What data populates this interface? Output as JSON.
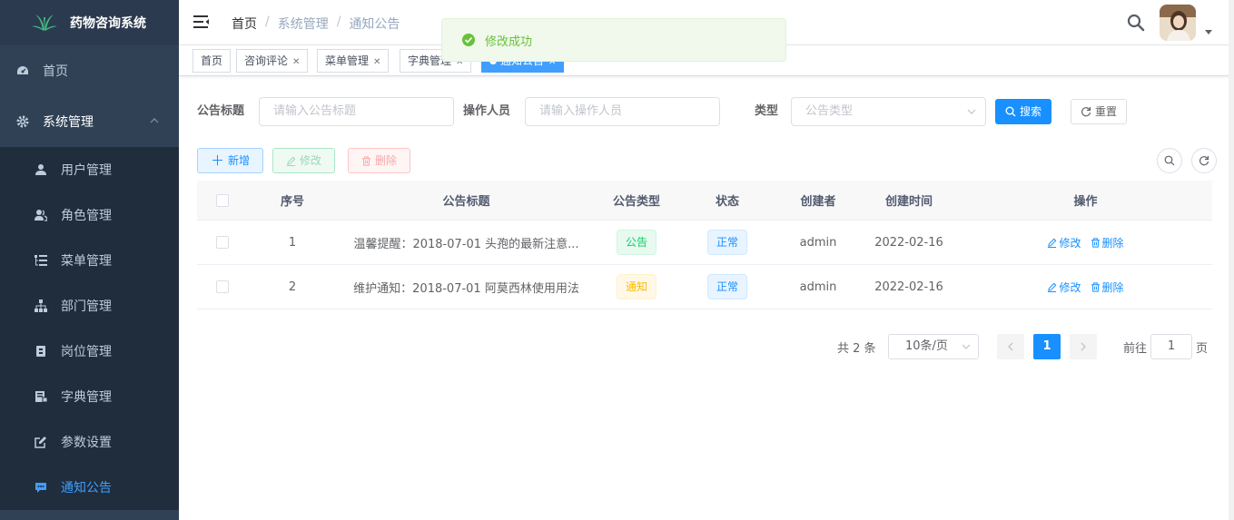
{
  "app": {
    "title": "药物咨询系统"
  },
  "sidebar": {
    "home": "首页",
    "system": "系统管理",
    "items": [
      {
        "label": "用户管理",
        "icon": "user-icon"
      },
      {
        "label": "角色管理",
        "icon": "peoples-icon"
      },
      {
        "label": "菜单管理",
        "icon": "tree-table-icon"
      },
      {
        "label": "部门管理",
        "icon": "tree-icon"
      },
      {
        "label": "岗位管理",
        "icon": "post-icon"
      },
      {
        "label": "字典管理",
        "icon": "dict-icon"
      },
      {
        "label": "参数设置",
        "icon": "edit-icon"
      },
      {
        "label": "通知公告",
        "icon": "message-icon",
        "active": true
      }
    ]
  },
  "breadcrumb": [
    "首页",
    "系统管理",
    "通知公告"
  ],
  "tags": [
    "首页",
    "咨询评论",
    "菜单管理",
    "字典管理",
    "通知公告"
  ],
  "toast": {
    "message": "修改成功",
    "color": "#67c23a"
  },
  "search": {
    "title_label": "公告标题",
    "title_placeholder": "请输入公告标题",
    "operator_label": "操作人员",
    "operator_placeholder": "请输入操作人员",
    "type_label": "类型",
    "type_placeholder": "公告类型",
    "search_btn": "搜索",
    "reset_btn": "重置"
  },
  "toolbar": {
    "add": "新增",
    "edit": "修改",
    "delete": "删除"
  },
  "table": {
    "headers": [
      "序号",
      "公告标题",
      "公告类型",
      "状态",
      "创建者",
      "创建时间",
      "操作"
    ],
    "rows": [
      {
        "no": "1",
        "title": "温馨提醒：2018-07-01 头孢的最新注意...",
        "type": "公告",
        "status": "正常",
        "creator": "admin",
        "time": "2022-02-16",
        "edit": "修改",
        "delete": "删除"
      },
      {
        "no": "2",
        "title": "维护通知：2018-07-01 阿莫西林使用用法",
        "type": "通知",
        "status": "正常",
        "creator": "admin",
        "time": "2022-02-16",
        "edit": "修改",
        "delete": "删除"
      }
    ]
  },
  "pagination": {
    "total": "共 2 条",
    "size": "10条/页",
    "current": "1",
    "goto": "前往",
    "goto_value": "1",
    "page": "页"
  },
  "colors": {
    "sidebar": "#304156",
    "primary": "#1890ff",
    "active_menu": "#409eff"
  }
}
